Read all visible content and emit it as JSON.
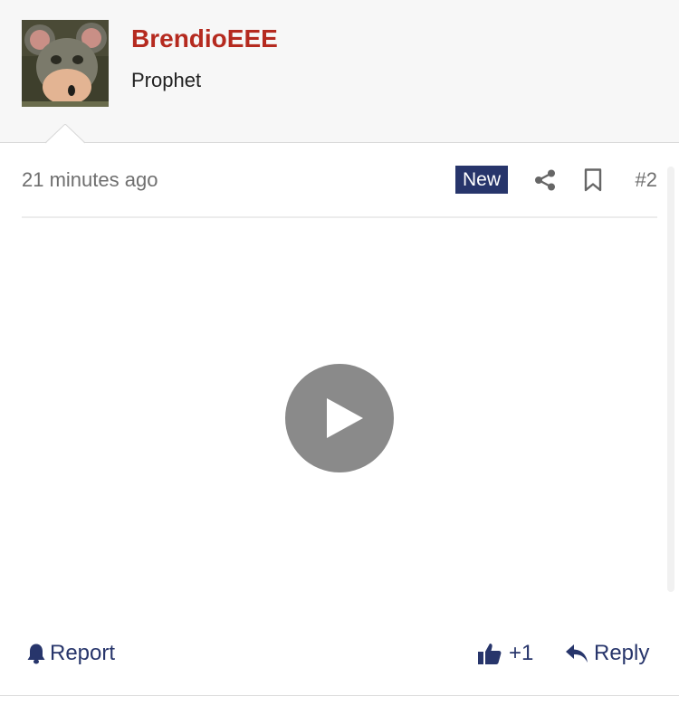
{
  "author": {
    "username": "BrendioEEE",
    "title": "Prophet",
    "avatar_icon": "mouse-character-avatar"
  },
  "post_meta": {
    "timestamp": "21 minutes ago",
    "badge": "New",
    "share_icon": "share-icon",
    "bookmark_icon": "bookmark-icon",
    "post_number": "#2"
  },
  "media": {
    "type": "video",
    "play_icon": "play-icon"
  },
  "actions": {
    "report_label": "Report",
    "like_count": "+1",
    "reply_label": "Reply"
  },
  "colors": {
    "username": "#b52a1f",
    "accent": "#27356b",
    "muted_text": "#6f6f6f",
    "header_bg": "#f7f7f7",
    "play_button": "#8a8a8a"
  }
}
